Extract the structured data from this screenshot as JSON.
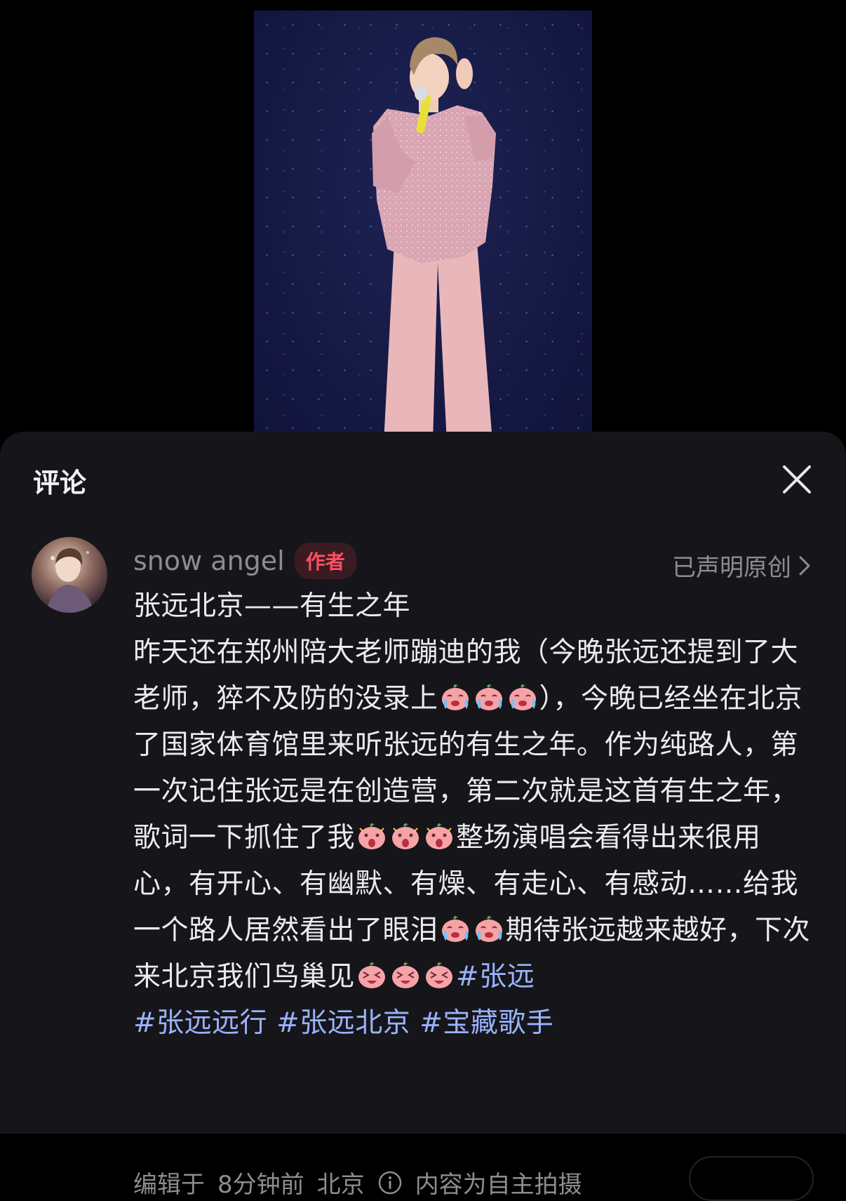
{
  "sheet": {
    "title": "评论",
    "close_icon": "close-icon"
  },
  "comment": {
    "author": "snow angel",
    "badge": "作者",
    "original_claim": "已声明原创",
    "title_line": "张远北京——有生之年",
    "body_parts": [
      "昨天还在郑州陪大老师蹦迪的我（今晚张远还提到了大老师，猝不及防的没录上",
      "），今晚已经坐在北京了国家体育馆里来听张远的有生之年。作为纯路人，第一次记住张远是在创造营，第二次就是这首有生之年，歌词一下抓住了我",
      "整场演唱会看得出来很用心，有开心、有幽默、有燥、有走心、有感动……给我一个路人居然看出了眼泪",
      "期待张远越来越好，下次来北京我们鸟巢见"
    ],
    "hashtags": [
      "#张远",
      "#张远远行",
      "#张远北京",
      "#宝藏歌手"
    ],
    "meta": {
      "edited_label": "编辑于",
      "time": "8分钟前",
      "location": "北京",
      "source_note": "内容为自主拍摄"
    }
  },
  "colors": {
    "sheet_bg": "#16161a",
    "badge_text": "#ff4f62",
    "hashtag": "#9ab2ff",
    "muted": "#8c8c92"
  }
}
